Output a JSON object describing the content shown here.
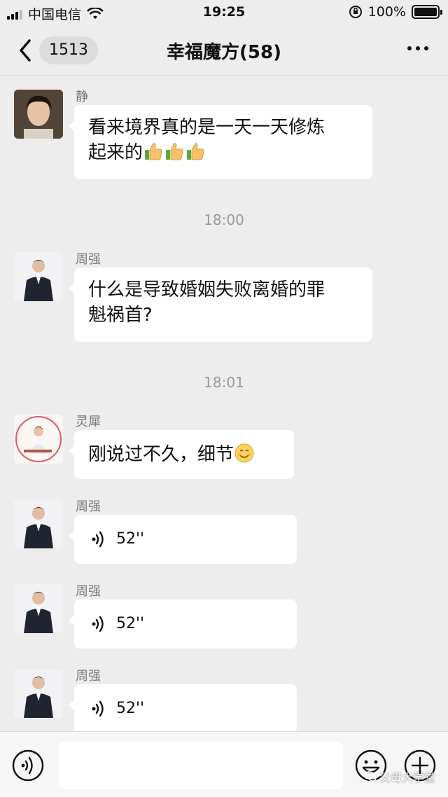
{
  "status_bar": {
    "carrier": "中国电信",
    "time": "19:25",
    "battery": "100%"
  },
  "nav": {
    "unread_count": "1513",
    "title": "幸福魔方(58)"
  },
  "messages": [
    {
      "sender": "静",
      "text_line1": "看来境界真的是一天一天修炼",
      "text_line2": "起来的",
      "thumbs_emoji_count": 3
    },
    {
      "timestamp": "18:00"
    },
    {
      "sender": "周强",
      "text_line1": "什么是导致婚姻失败离婚的罪",
      "text_line2": "魁祸首?"
    },
    {
      "timestamp": "18:01"
    },
    {
      "sender": "灵犀",
      "text": "刚说过不久，细节"
    },
    {
      "sender": "周强",
      "voice_duration": "52''"
    },
    {
      "sender": "周强",
      "voice_duration": "52''"
    },
    {
      "sender": "周强",
      "voice_duration": "52''"
    }
  ],
  "input": {
    "placeholder": ""
  },
  "watermark": "父母大学堂",
  "colors": {
    "background": "#ededed",
    "bubble": "#ffffff",
    "meta_text": "#9a9a9a"
  },
  "icons": {
    "back": "chevron-left-icon",
    "more": "more-dots-icon",
    "voice": "voice-wave-icon",
    "emoji": "smiley-icon",
    "plus": "plus-circle-icon"
  }
}
